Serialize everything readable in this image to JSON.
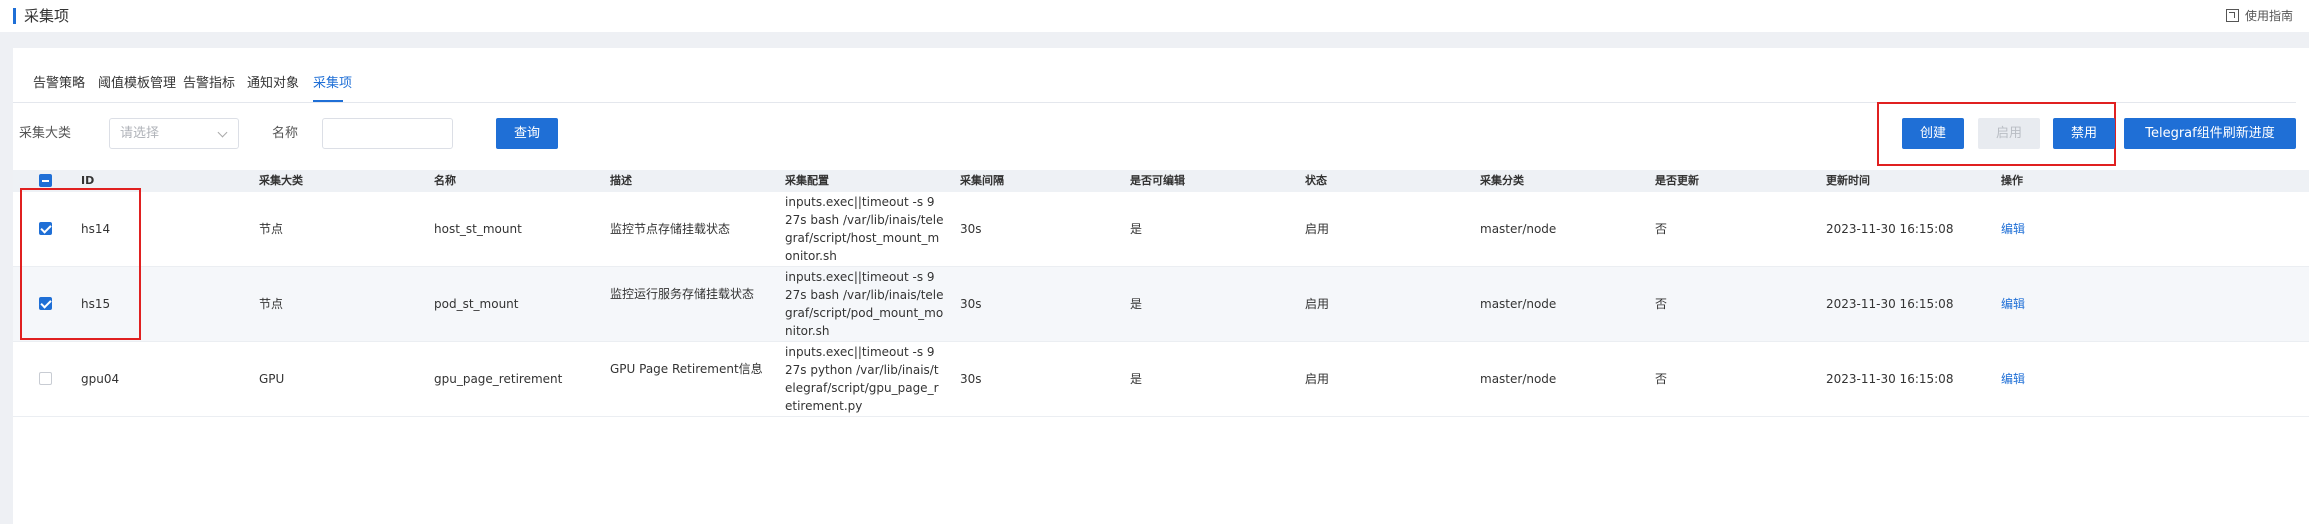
{
  "header": {
    "title": "采集项",
    "guide_label": "使用指南"
  },
  "tabs": [
    {
      "label": "告警策略"
    },
    {
      "label": "阈值模板管理"
    },
    {
      "label": "告警指标"
    },
    {
      "label": "通知对象"
    },
    {
      "label": "采集项",
      "active": true
    }
  ],
  "filters": {
    "category_label": "采集大类",
    "category_placeholder": "请选择",
    "name_label": "名称",
    "name_value": "",
    "query_label": "查询"
  },
  "actions": {
    "create_label": "创建",
    "enable_label": "启用",
    "disable_label": "禁用",
    "refresh_label": "Telegraf组件刷新进度"
  },
  "table": {
    "columns": [
      "ID",
      "采集大类",
      "名称",
      "描述",
      "采集配置",
      "采集间隔",
      "是否可编辑",
      "状态",
      "采集分类",
      "是否更新",
      "更新时间",
      "操作"
    ],
    "rows": [
      {
        "checked": true,
        "id": "hs14",
        "category": "节点",
        "name": "host_st_mount",
        "desc": "监控节点存储挂载状态",
        "config": "inputs.exec||timeout -s 9 27s bash /var/lib/inais/telegraf/script/host_mount_monitor.sh",
        "interval": "30s",
        "editable": "是",
        "status": "启用",
        "classification": "master/node",
        "updated": "否",
        "update_time": "2023-11-30 16:15:08",
        "action": "编辑"
      },
      {
        "checked": true,
        "id": "hs15",
        "category": "节点",
        "name": "pod_st_mount",
        "desc": "监控运行服务存储挂载状态",
        "config": "inputs.exec||timeout -s 9 27s bash /var/lib/inais/telegraf/script/pod_mount_monitor.sh",
        "interval": "30s",
        "editable": "是",
        "status": "启用",
        "classification": "master/node",
        "updated": "否",
        "update_time": "2023-11-30 16:15:08",
        "action": "编辑"
      },
      {
        "checked": false,
        "id": "gpu04",
        "category": "GPU",
        "name": "gpu_page_retirement",
        "desc": "GPU Page Retirement信息",
        "config": "inputs.exec||timeout -s 9 27s python /var/lib/inais/telegraf/script/gpu_page_retirement.py",
        "interval": "30s",
        "editable": "是",
        "status": "启用",
        "classification": "master/node",
        "updated": "否",
        "update_time": "2023-11-30 16:15:08",
        "action": "编辑"
      }
    ]
  },
  "colors": {
    "primary": "#1f6fd6",
    "highlight_box": "#e02020",
    "page_bg": "#eef0f4"
  }
}
